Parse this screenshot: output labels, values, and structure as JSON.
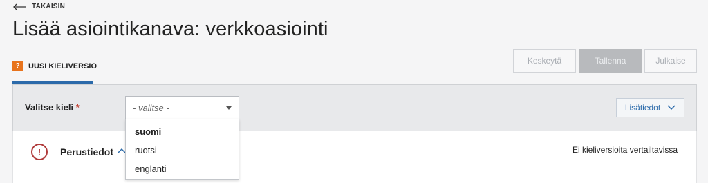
{
  "nav": {
    "back_label": "TAKAISIN"
  },
  "page": {
    "title": "Lisää asiointikanava: verkkoasiointi"
  },
  "tabs": [
    {
      "badge": "?",
      "label": "UUSI KIELIVERSIO"
    }
  ],
  "actions": {
    "cancel_label": "Keskeytä",
    "save_label": "Tallenna",
    "publish_label": "Julkaise"
  },
  "language_select": {
    "label": "Valitse kieli",
    "required_marker": "*",
    "placeholder": "- valitse -",
    "options": [
      {
        "label": "suomi",
        "highlighted": true
      },
      {
        "label": "ruotsi",
        "highlighted": false
      },
      {
        "label": "englanti",
        "highlighted": false
      }
    ]
  },
  "info_button": {
    "label": "Lisätiedot",
    "icon": "chevron-down-icon"
  },
  "section": {
    "alert_symbol": "!",
    "title": "Perustiedot",
    "icon": "chevron-up-icon"
  },
  "compare": {
    "text": "Ei kieliversioita vertailtavissa"
  },
  "colors": {
    "accent": "#2b6aaa",
    "badge": "#e8731c",
    "alert": "#b03a3a"
  }
}
